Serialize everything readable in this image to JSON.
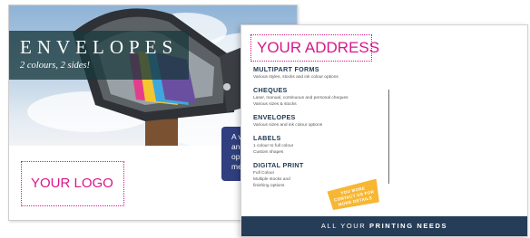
{
  "back_card": {
    "title": "ENVELOPES",
    "subtitle": "2 colours, 2 sides!",
    "info_lines": [
      "A var",
      "and i",
      "optio",
      "meet"
    ],
    "logo_placeholder": "YOUR LOGO"
  },
  "front_card": {
    "address_placeholder": "YOUR ADDRESS",
    "services": [
      {
        "heading": "MULTIPART FORMS",
        "details": [
          "Various styles, stocks and ink colour options"
        ]
      },
      {
        "heading": "CHEQUES",
        "details": [
          "Laser, manual, continuous and personal cheques",
          "Various sizes & stocks"
        ]
      },
      {
        "heading": "ENVELOPES",
        "details": [
          "Various sizes and ink colour options"
        ]
      },
      {
        "heading": "LABELS",
        "details": [
          "1 colour to full colour",
          "Custom shapes"
        ]
      },
      {
        "heading": "DIGITAL PRINT",
        "details": [
          "Full Colour",
          "Multiple stocks and",
          "finishing options"
        ]
      }
    ],
    "badge_lines": [
      "YOU MORE",
      "CONTACT US FOR",
      "MORE DETAILS"
    ],
    "footer": {
      "prefix": "ALL YOUR ",
      "bold": "PRINTING NEEDS"
    }
  },
  "colors": {
    "accent_magenta": "#d8168a",
    "navy": "#263d58",
    "info_blue": "#2f3f7f",
    "badge_yellow": "#f7b733"
  }
}
